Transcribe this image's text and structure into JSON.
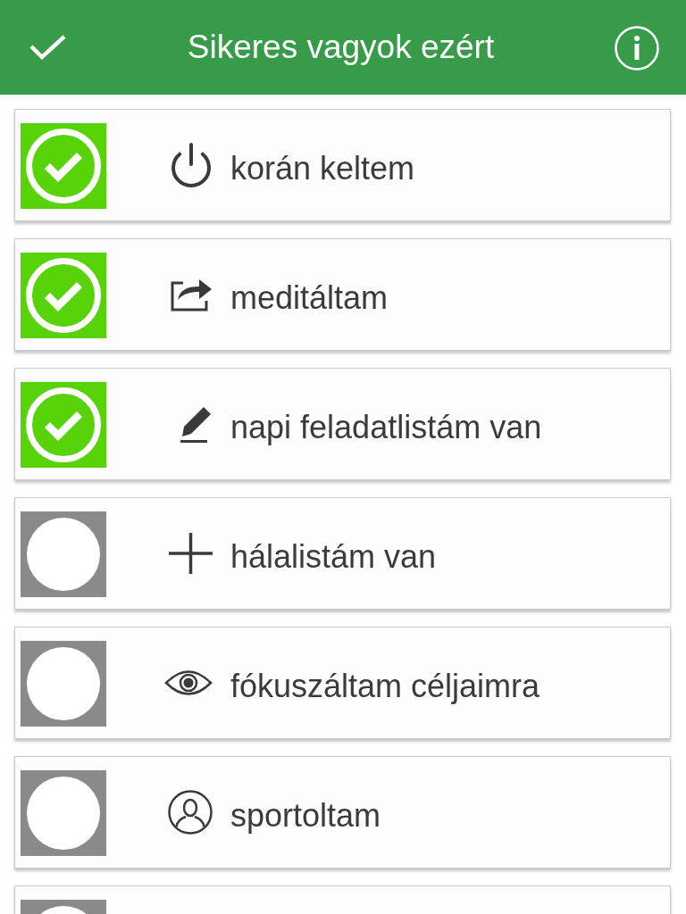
{
  "header": {
    "title": "Sikeres vagyok ezért"
  },
  "items": [
    {
      "label": "korán keltem",
      "checked": true
    },
    {
      "label": "meditáltam",
      "checked": true
    },
    {
      "label": "napi feladatlistám van",
      "checked": true
    },
    {
      "label": "hálalistám van",
      "checked": false
    },
    {
      "label": "fókuszáltam céljaimra",
      "checked": false
    },
    {
      "label": "sportoltam",
      "checked": false
    },
    {
      "checked": false
    }
  ]
}
